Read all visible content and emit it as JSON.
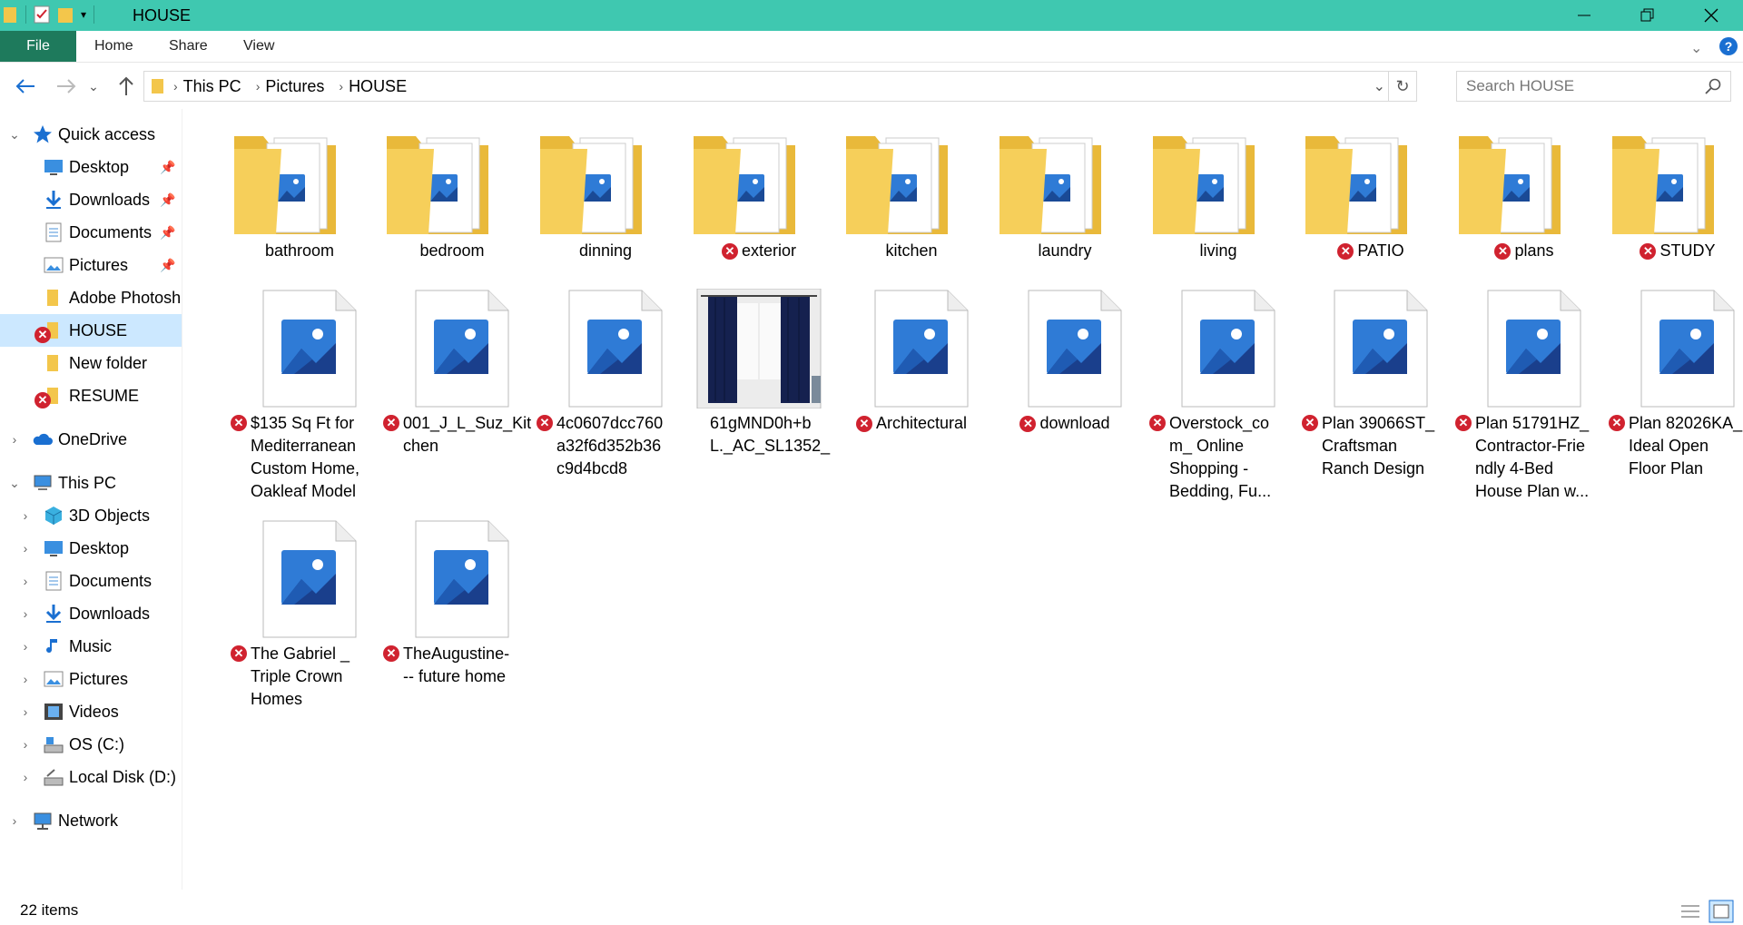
{
  "window": {
    "title": "HOUSE",
    "accent": "#3fc8b0"
  },
  "ribbon": {
    "file": "File",
    "tabs": [
      "Home",
      "Share",
      "View"
    ]
  },
  "address": {
    "segments": [
      "This PC",
      "Pictures",
      "HOUSE"
    ],
    "search_placeholder": "Search HOUSE"
  },
  "sidebar": {
    "quick_access": "Quick access",
    "qa_items": [
      {
        "label": "Desktop",
        "icon": "desktop-icon",
        "pinned": true
      },
      {
        "label": "Downloads",
        "icon": "downloads-icon",
        "pinned": true
      },
      {
        "label": "Documents",
        "icon": "documents-icon",
        "pinned": true
      },
      {
        "label": "Pictures",
        "icon": "pictures-icon",
        "pinned": true
      },
      {
        "label": "Adobe Photoshop",
        "icon": "folder-icon",
        "pinned": false
      },
      {
        "label": "HOUSE",
        "icon": "folder-icon",
        "pinned": false,
        "error": true,
        "selected": true
      },
      {
        "label": "New folder",
        "icon": "folder-icon",
        "pinned": false
      },
      {
        "label": "RESUME",
        "icon": "folder-icon",
        "pinned": false,
        "error": true
      }
    ],
    "onedrive": "OneDrive",
    "this_pc": "This PC",
    "pc_items": [
      {
        "label": "3D Objects",
        "icon": "3d-objects-icon"
      },
      {
        "label": "Desktop",
        "icon": "desktop-icon"
      },
      {
        "label": "Documents",
        "icon": "documents-icon"
      },
      {
        "label": "Downloads",
        "icon": "downloads-icon"
      },
      {
        "label": "Music",
        "icon": "music-icon"
      },
      {
        "label": "Pictures",
        "icon": "pictures-icon"
      },
      {
        "label": "Videos",
        "icon": "videos-icon"
      },
      {
        "label": "OS (C:)",
        "icon": "drive-c-icon"
      },
      {
        "label": "Local Disk (D:)",
        "icon": "drive-d-icon"
      }
    ],
    "network": "Network"
  },
  "items": [
    {
      "name": "bathroom",
      "type": "folder",
      "error": false
    },
    {
      "name": "bedroom",
      "type": "folder",
      "error": false
    },
    {
      "name": "dinning",
      "type": "folder",
      "error": false
    },
    {
      "name": "exterior",
      "type": "folder",
      "error": true
    },
    {
      "name": "kitchen",
      "type": "folder",
      "error": false
    },
    {
      "name": "laundry",
      "type": "folder",
      "error": false
    },
    {
      "name": "living",
      "type": "folder",
      "error": false
    },
    {
      "name": "PATIO",
      "type": "folder",
      "error": true
    },
    {
      "name": "plans",
      "type": "folder",
      "error": true
    },
    {
      "name": "STUDY",
      "type": "folder",
      "error": true
    },
    {
      "name": "$135 Sq Ft for Mediterranean Custom Home, Oakleaf Model",
      "lines": [
        "$135 Sq Ft for",
        "Mediterranean",
        "Custom Home,",
        "Oakleaf Model"
      ],
      "type": "image",
      "error": true
    },
    {
      "name": "001_J_L_Suz_Kitchen",
      "lines": [
        "001_J_L_Suz_Kit",
        "chen"
      ],
      "type": "image",
      "error": true
    },
    {
      "name": "4c0607dcc760a32f6d352b36c9d4bcd8",
      "lines": [
        "4c0607dcc760",
        "a32f6d352b36",
        "c9d4bcd8"
      ],
      "type": "image",
      "error": true
    },
    {
      "name": "61gMND0h+bL._AC_SL1352_",
      "lines": [
        "61gMND0h+b",
        "L._AC_SL1352_"
      ],
      "type": "photo",
      "error": false
    },
    {
      "name": "Architectural",
      "type": "image",
      "error": true
    },
    {
      "name": "download",
      "type": "image",
      "error": true
    },
    {
      "name": "Overstock_com_ Online Shopping - Bedding, Fu...",
      "lines": [
        "Overstock_co",
        "m_ Online",
        "Shopping -",
        "Bedding, Fu..."
      ],
      "type": "image",
      "error": true
    },
    {
      "name": "Plan 39066ST_ Craftsman Ranch Design",
      "lines": [
        "Plan 39066ST_",
        "Craftsman",
        "Ranch Design"
      ],
      "type": "image",
      "error": true
    },
    {
      "name": "Plan 51791HZ_ Contractor-Friendly 4-Bed House Plan w...",
      "lines": [
        "Plan 51791HZ_",
        "Contractor-Frie",
        "ndly 4-Bed",
        "House Plan w..."
      ],
      "type": "image",
      "error": true
    },
    {
      "name": "Plan 82026KA_ Ideal Open Floor Plan",
      "lines": [
        "Plan 82026KA_",
        "Ideal Open",
        "Floor Plan"
      ],
      "type": "image",
      "error": true
    },
    {
      "name": "The Gabriel _ Triple Crown Homes",
      "lines": [
        "The Gabriel _",
        "Triple Crown",
        "Homes"
      ],
      "type": "image",
      "error": true
    },
    {
      "name": "TheAugustine--- future home",
      "lines": [
        "TheAugustine-",
        "-- future home"
      ],
      "type": "image",
      "error": true
    }
  ],
  "status": {
    "count": "22 items"
  }
}
